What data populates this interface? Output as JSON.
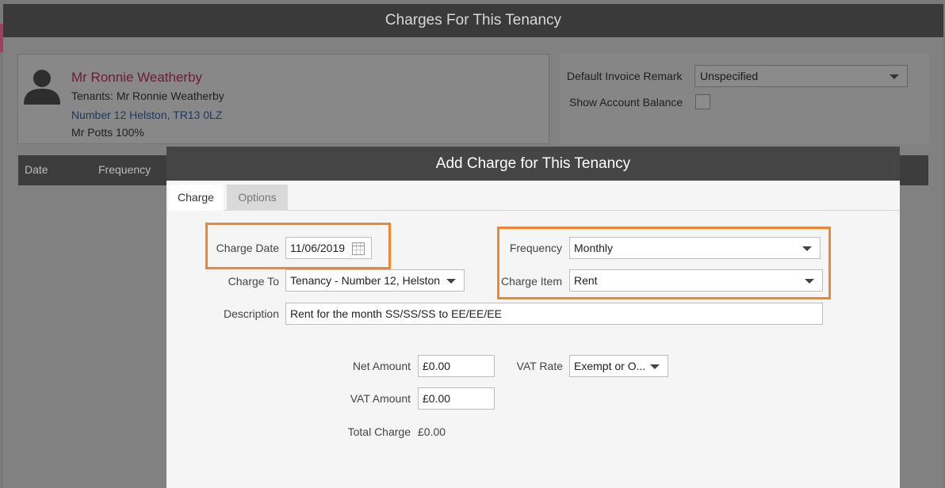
{
  "window": {
    "title": "Charges For This Tenancy"
  },
  "tenant": {
    "name": "Mr Ronnie Weatherby",
    "tenants_line": "Tenants: Mr Ronnie Weatherby",
    "address": "Number 12 Helston, TR13 0LZ",
    "owner": "Mr Potts 100%"
  },
  "invoice": {
    "default_remark_label": "Default Invoice Remark",
    "default_remark_value": "Unspecified",
    "show_balance_label": "Show Account Balance"
  },
  "grid": {
    "columns": [
      "Date",
      "Frequency"
    ]
  },
  "dialog": {
    "title": "Add Charge for This Tenancy",
    "tabs": [
      "Charge",
      "Options"
    ],
    "charge_date_label": "Charge Date",
    "charge_date_value": "11/06/2019",
    "charge_to_label": "Charge To",
    "charge_to_value": "Tenancy - Number 12, Helston",
    "frequency_label": "Frequency",
    "frequency_value": "Monthly",
    "charge_item_label": "Charge Item",
    "charge_item_value": "Rent",
    "description_label": "Description",
    "description_value": "Rent for the month SS/SS/SS to EE/EE/EE",
    "net_amount_label": "Net Amount",
    "net_amount_value": "£0.00",
    "vat_rate_label": "VAT Rate",
    "vat_rate_value": "Exempt or O...",
    "vat_amount_label": "VAT Amount",
    "vat_amount_value": "£0.00",
    "total_charge_label": "Total Charge",
    "total_charge_value": "£0.00"
  },
  "colors": {
    "highlight": "#f08532",
    "titlebar": "#454545",
    "tenant_name": "#b0204a"
  }
}
